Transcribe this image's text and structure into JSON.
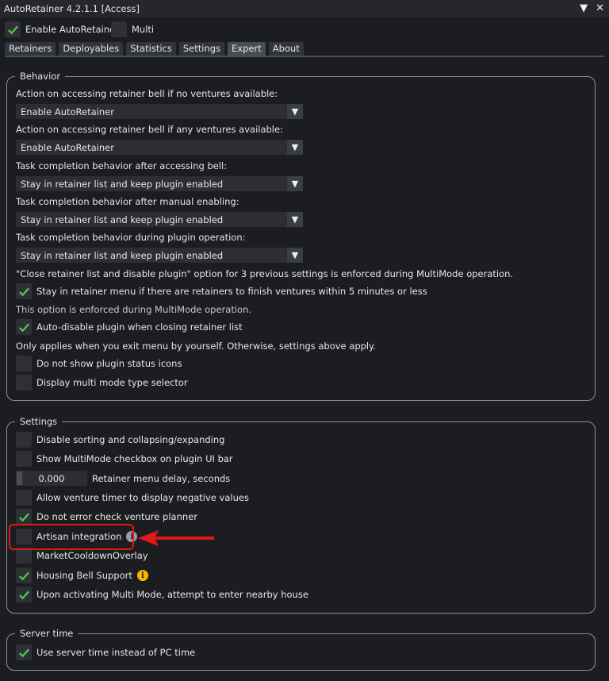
{
  "window": {
    "title": "AutoRetainer 4.2.1.1 [Access]",
    "controls": [
      "▼",
      "✕"
    ]
  },
  "topbar": {
    "enable_label": "Enable AutoRetainer",
    "enable_checked": true,
    "multi_label": "Multi",
    "multi_checked": false
  },
  "tabs": [
    "Retainers",
    "Deployables",
    "Statistics",
    "Settings",
    "Expert",
    "About"
  ],
  "active_tab": "Expert",
  "behavior": {
    "title": "Behavior",
    "label1": "Action on accessing retainer bell if no ventures available:",
    "combo1": "Enable AutoRetainer",
    "label2": "Action on accessing retainer bell if any ventures available:",
    "combo2": "Enable AutoRetainer",
    "label3": "Task completion behavior after accessing bell:",
    "combo3": "Stay in retainer list and keep plugin enabled",
    "label4": "Task completion behavior after manual enabling:",
    "combo4": "Stay in retainer list and keep plugin enabled",
    "label5": "Task completion behavior during plugin operation:",
    "combo5": "Stay in retainer list and keep plugin enabled",
    "note1": "\"Close retainer list and disable plugin\" option for 3 previous settings is enforced during MultiMode operation.",
    "stay_label": "Stay in retainer menu if there are retainers to finish ventures within 5 minutes or less",
    "note2": "This option is enforced during MultiMode operation.",
    "autodisable_label": "Auto-disable plugin when closing retainer list",
    "note3": "Only applies when you exit menu by yourself. Otherwise, settings above apply.",
    "no_status_icons_label": "Do not show plugin status icons",
    "multimode_selector_label": "Display multi mode type selector"
  },
  "settings": {
    "title": "Settings",
    "disable_sorting_label": "Disable sorting and collapsing/expanding",
    "show_multimode_label": "Show MultiMode checkbox on plugin UI bar",
    "delay_value": "0.000",
    "delay_label": "Retainer menu delay, seconds",
    "negative_timer_label": "Allow venture timer to display negative values",
    "no_error_check_label": "Do not error check venture planner",
    "artisan_label": "Artisan integration",
    "market_overlay_label": "MarketCooldownOverlay",
    "housing_bell_label": "Housing Bell Support",
    "enter_house_label": "Upon activating Multi Mode, attempt to enter nearby house"
  },
  "server_time": {
    "title": "Server time",
    "use_server_time_label": "Use server time instead of PC time"
  },
  "colors": {
    "check": "#4ec94e",
    "highlight": "#e01818",
    "info_yellow": "#f5b800"
  },
  "icons": {
    "combo_arrow": "▼",
    "info": "i"
  }
}
